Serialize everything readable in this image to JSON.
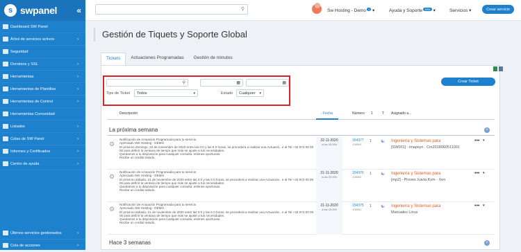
{
  "brand": {
    "name": "swpanel",
    "collapse": "«"
  },
  "sidebar": {
    "items": [
      {
        "label": "Dashboard SW Panel",
        "chevron": ""
      },
      {
        "label": "Árbol de servicios activos",
        "chevron": "›"
      },
      {
        "label": "Seguridad",
        "chevron": ""
      },
      {
        "label": "Dominios y SSL",
        "chevron": "›"
      },
      {
        "label": "Herramientas",
        "chevron": "›"
      },
      {
        "label": "Herramientas de Plantillas",
        "chevron": "›"
      },
      {
        "label": "Herramientas de Control",
        "chevron": "›"
      },
      {
        "label": "Herramientas Comunidad",
        "chevron": ""
      },
      {
        "label": "Listados",
        "chevron": "›"
      },
      {
        "label": "Colas de SW Panel",
        "chevron": "›"
      },
      {
        "label": "Informes y Certificados",
        "chevron": "›"
      },
      {
        "label": "Centro de ayuda",
        "chevron": "›"
      }
    ],
    "bottom": [
      {
        "label": "Últimos servicios gestionados",
        "chevron": "›"
      },
      {
        "label": "Cola de acciones",
        "chevron": "›"
      }
    ]
  },
  "topbar": {
    "search_placeholder": "",
    "account": "Sw Hosting - Demo",
    "account_badge": "1",
    "support": "Ayuda y Soporte",
    "support_badge": "1051",
    "services": "Servicios",
    "create_service": "Crear servicio"
  },
  "page": {
    "title": "Gestión de Tiquets y Soporte Global",
    "tabs": [
      "Tickets",
      "Actuaciones Programadas",
      "Gestión de minutos"
    ]
  },
  "filters": {
    "ticket_type_label": "Tipo de Ticket",
    "ticket_type_value": "Todos",
    "status_label": "Estado",
    "status_value": "Cualquier",
    "create_ticket": "Crear Ticket"
  },
  "table": {
    "headers": {
      "description": "Descripción",
      "date": "Fecha",
      "number": "Número",
      "col1": "1",
      "colT": "T",
      "assigned": "Asignado a..."
    },
    "groups": [
      {
        "title": "La próxima semana"
      },
      {
        "title": "Hace 3 semanas"
      }
    ],
    "rows": [
      {
        "desc": "Notificación de Actuación Programada para tu servicio\nApreciado SW Hosting - DEMO\nEl próximo domingo, 22 de noviembre de 2020 entre las 0:0 y las 6 0 horas, se procederá a realizar una Actuació.. e al Tel +34 972 00 00 00 para definir la ventana de tiempo que más se ajuste a tus necesidades.\nQuedamos a tu disposición para cualquier consulta. estimes oportunas.\nRecibe un cordial saludo.",
        "date": "22-11-2020",
        "time": "a las 00:00h",
        "number": "154377",
        "sub": "108963",
        "c1": "1",
        "assign": "Ingeniería y Sistemas para",
        "assign2": "[SW001] - imapsyn . Cm2018060511001"
      },
      {
        "desc": "Notificación de Actuación Programada para tu servicio\nApreciado SW Hosting - DEMO\nEl próximo sábado, 21 de noviembre de 2020 entre las 0:0 y las 6 0 horas, se procederá a realizar una Actuación.. e al Tel +34 972 00 00 00 para definir la ventana de tiempo que más se ajuste a tus necesidades.\nQuedamos a tu disposición para cualquier consulta. estimes oportunas.\nRecibe un cordial saludo.",
        "date": "21-11-2020",
        "time": "a las 00:00h",
        "number": "154376",
        "sub": "108962",
        "c1": "1",
        "assign": "Ingeniería y Sistemas para",
        "assign2": "[mp2] - Proves Xavia Kvm - Xen"
      },
      {
        "desc": "Notificación de Actuación Programada para tu servicio\nApreciado SW Hosting - DEMO\nEl próximo sábado, 21 de noviembre de 2020 entre las 0:0 y las 6 0 horas, se procederá a realizar una Actuación.. e al Tel +34 972 00 00 00 para definir la ventana de tiempo que más se ajuste a tus necesidades.\nQuedamos a tu disposición para cualquier consulta. estimes oportunas.\nRecibe un cordial saludo.",
        "date": "21-11-2020",
        "time": "a las 00:00h",
        "number": "154375",
        "sub": "108961",
        "c1": "1",
        "assign": "Ingeniería y Sistemas para",
        "assign2": "Manuales Linux"
      }
    ]
  }
}
